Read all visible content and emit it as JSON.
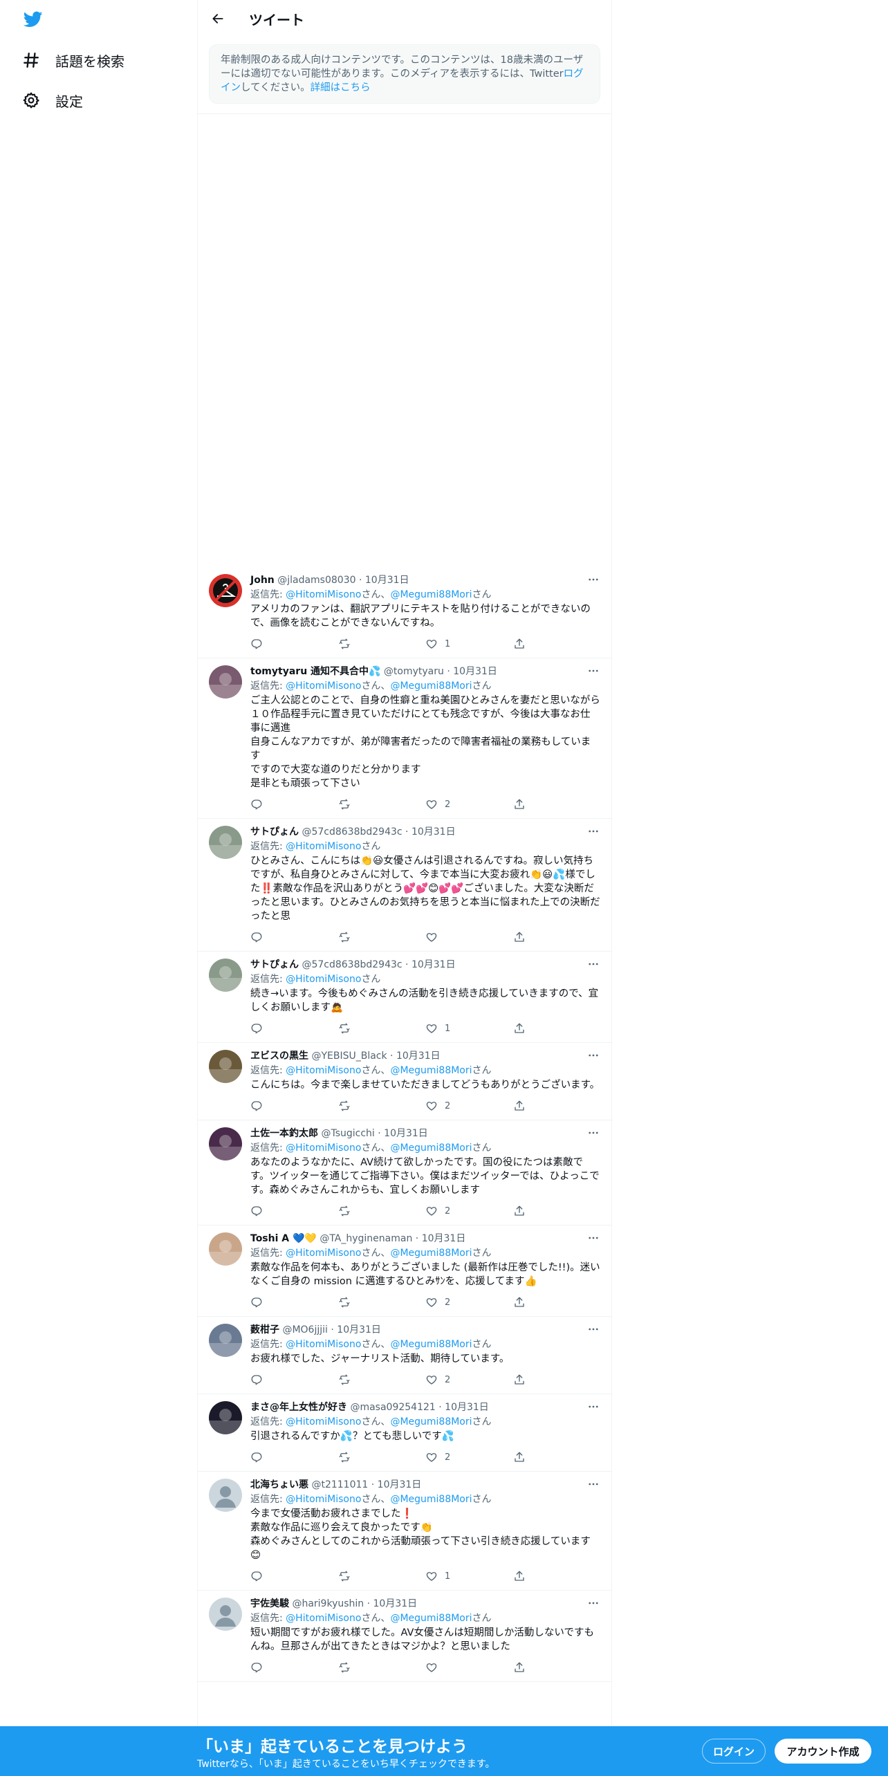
{
  "nav": {
    "explore_label": "話題を検索",
    "settings_label": "設定"
  },
  "header": {
    "title": "ツイート"
  },
  "notice": {
    "text": "年齢制限のある成人向けコンテンツです。このコンテンツは、18歳未満のユーザーには適切でない可能性があります。このメディアを表示するには、Twitter",
    "link_login": "ログイン",
    "middle": "してください。",
    "link_more": "詳細はこちら"
  },
  "replies": [
    {
      "display_name": "John",
      "handle": "@jladams08030",
      "date": "10月31日",
      "reply_prefix": "返信先: ",
      "reply_mentions": [
        {
          "mention": "@HitomiMisono",
          "suffix": "さん、"
        },
        {
          "mention": "@Megumi88Mori",
          "suffix": "さん"
        }
      ],
      "text": "アメリカのファンは、翻訳アプリにテキストを貼り付けることができないので、画像を読むことができないんですね。",
      "likes": "1",
      "avatar": {
        "bg": "#d9312c",
        "icon": "hanger-icon"
      }
    },
    {
      "display_name": "tomytyaru 通知不具合中💦",
      "handle": "@tomytyaru",
      "date": "10月31日",
      "reply_prefix": "返信先: ",
      "reply_mentions": [
        {
          "mention": "@HitomiMisono",
          "suffix": "さん、"
        },
        {
          "mention": "@Megumi88Mori",
          "suffix": "さん"
        }
      ],
      "text": "ご主人公認とのことで、自身の性癖と重ね美園ひとみさんを妻だと思いながら１０作品程手元に置き見ていただけにとても残念ですが、今後は大事なお仕事に邁進\n自身こんなアカですが、弟が障害者だったので障害者福祉の業務もしています\nですので大変な道のりだと分かります\n是非とも頑張って下さい",
      "likes": "2",
      "avatar": {
        "bg": "#7a5a6e",
        "icon": "photo-avatar"
      }
    },
    {
      "display_name": "サトぴょん",
      "handle": "@57cd8638bd2943c",
      "date": "10月31日",
      "reply_prefix": "返信先: ",
      "reply_mentions": [
        {
          "mention": "@HitomiMisono",
          "suffix": "さん"
        }
      ],
      "text": "ひとみさん、こんにちは👏😃女優さんは引退されるんですね。寂しい気持ちですが、私自身ひとみさんに対して、今まで本当に大変お疲れ👏😃💦様でした‼️素敵な作品を沢山ありがとう💕💕😊💕💕ございました。大変な決断だったと思います。ひとみさんのお気持ちを思うと本当に悩まれた上での決断だったと思",
      "likes": "",
      "avatar": {
        "bg": "#8a9a8a",
        "icon": "photo-avatar"
      }
    },
    {
      "display_name": "サトぴょん",
      "handle": "@57cd8638bd2943c",
      "date": "10月31日",
      "reply_prefix": "返信先: ",
      "reply_mentions": [
        {
          "mention": "@HitomiMisono",
          "suffix": "さん"
        }
      ],
      "text": "続き→います。今後もめぐみさんの活動を引き続き応援していきますので、宜しくお願いします🙇",
      "likes": "1",
      "avatar": {
        "bg": "#8a9a8a",
        "icon": "photo-avatar"
      }
    },
    {
      "display_name": "ヱビスの黒生",
      "handle": "@YEBISU_Black",
      "date": "10月31日",
      "reply_prefix": "返信先: ",
      "reply_mentions": [
        {
          "mention": "@HitomiMisono",
          "suffix": "さん、"
        },
        {
          "mention": "@Megumi88Mori",
          "suffix": "さん"
        }
      ],
      "text": "こんにちは。今まで楽しませていただきましてどうもありがとうございます。",
      "likes": "2",
      "avatar": {
        "bg": "#6b5a3a",
        "icon": "photo-avatar"
      }
    },
    {
      "display_name": "土佐一本釣太郎",
      "handle": "@Tsugicchi",
      "date": "10月31日",
      "reply_prefix": "返信先: ",
      "reply_mentions": [
        {
          "mention": "@HitomiMisono",
          "suffix": "さん、"
        },
        {
          "mention": "@Megumi88Mori",
          "suffix": "さん"
        }
      ],
      "text": "あなたのようなかたに、AV続けて欲しかったです。国の役にたつは素敵です。ツイッターを通じてご指導下さい。僕はまだツイッターでは、ひよっこです。森めぐみさんこれからも、宜しくお願いします",
      "likes": "2",
      "avatar": {
        "bg": "#4a2a4a",
        "icon": "photo-avatar"
      }
    },
    {
      "display_name": "Toshi A 💙💛",
      "handle": "@TA_hyginenaman",
      "date": "10月31日",
      "reply_prefix": "返信先: ",
      "reply_mentions": [
        {
          "mention": "@HitomiMisono",
          "suffix": "さん、"
        },
        {
          "mention": "@Megumi88Mori",
          "suffix": "さん"
        }
      ],
      "text": "素敵な作品を何本も、ありがとうございました (最新作は圧巻でした!!)。迷いなくご自身の mission に邁進するひとみｻﾝを、応援してます👍",
      "likes": "2",
      "avatar": {
        "bg": "#c9a68a",
        "icon": "photo-avatar"
      }
    },
    {
      "display_name": "薮柑子",
      "handle": "@MO6jjjii",
      "date": "10月31日",
      "reply_prefix": "返信先: ",
      "reply_mentions": [
        {
          "mention": "@HitomiMisono",
          "suffix": "さん、"
        },
        {
          "mention": "@Megumi88Mori",
          "suffix": "さん"
        }
      ],
      "text": "お疲れ様でした、ジャーナリスト活動、期待しています。",
      "likes": "2",
      "avatar": {
        "bg": "#6a7a92",
        "icon": "photo-avatar"
      }
    },
    {
      "display_name": "まさ@年上女性が好き",
      "handle": "@masa09254121",
      "date": "10月31日",
      "reply_prefix": "返信先: ",
      "reply_mentions": [
        {
          "mention": "@HitomiMisono",
          "suffix": "さん、"
        },
        {
          "mention": "@Megumi88Mori",
          "suffix": "さん"
        }
      ],
      "text": "引退されるんですか💦？とても悲しいです💦",
      "likes": "2",
      "avatar": {
        "bg": "#1a1a2a",
        "icon": "photo-avatar"
      }
    },
    {
      "display_name": "北海ちょい悪",
      "handle": "@t2111011",
      "date": "10月31日",
      "reply_prefix": "返信先: ",
      "reply_mentions": [
        {
          "mention": "@HitomiMisono",
          "suffix": "さん、"
        },
        {
          "mention": "@Megumi88Mori",
          "suffix": "さん"
        }
      ],
      "text": "今まで女優活動お疲れさまでした❗️\n素敵な作品に巡り会えて良かったです👏\n森めぐみさんとしてのこれから活動頑張って下さい引き続き応援しています😊",
      "likes": "1",
      "avatar": {
        "bg": "#ccd6dd",
        "icon": "default-avatar"
      }
    },
    {
      "display_name": "宇佐美駿",
      "handle": "@hari9kyushin",
      "date": "10月31日",
      "reply_prefix": "返信先: ",
      "reply_mentions": [
        {
          "mention": "@HitomiMisono",
          "suffix": "さん、"
        },
        {
          "mention": "@Megumi88Mori",
          "suffix": "さん"
        }
      ],
      "text": "短い期間ですがお疲れ様でした。AV女優さんは短期間しか活動しないですもんね。旦那さんが出てきたときはマジかよ？と思いました",
      "likes": "",
      "avatar": {
        "bg": "#ccd6dd",
        "icon": "default-avatar"
      }
    }
  ],
  "footer": {
    "title": "「いま」起きていることを見つけよう",
    "subtitle": "Twitterなら、「いま」起きていることをいち早くチェックできます。",
    "login_label": "ログイン",
    "signup_label": "アカウント作成"
  },
  "colors": {
    "accent": "#1d9bf0",
    "text": "#0f1419",
    "secondary": "#536471"
  }
}
